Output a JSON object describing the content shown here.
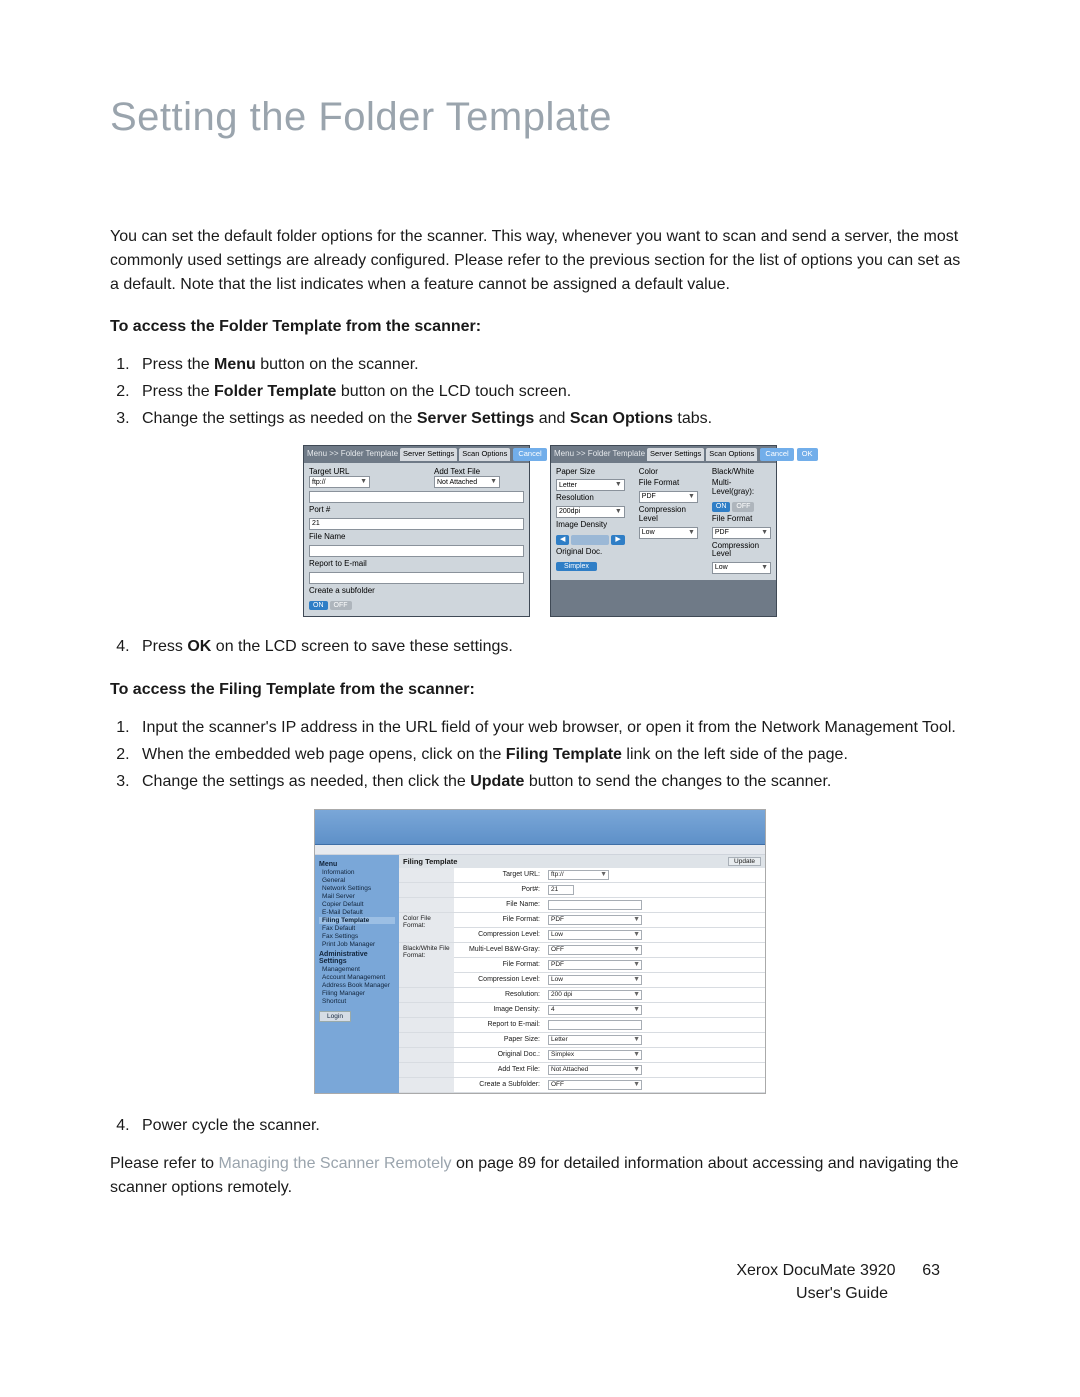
{
  "title": "Setting the Folder Template",
  "intro": "You can set the default folder options for the scanner. This way, whenever you want to scan and send a server, the most commonly used settings are already configured. Please refer to the previous section for the list of options you can set as a default. Note that the list indicates when a feature cannot be assigned a default value.",
  "section1_heading": "To access the Folder Template from the scanner:",
  "section1_steps": {
    "s1a": "Press the ",
    "s1b": "Menu",
    "s1c": " button on the scanner.",
    "s2a": "Press the ",
    "s2b": "Folder Template",
    "s2c": " button on the LCD touch screen.",
    "s3a": "Change the settings as needed on the ",
    "s3b": "Server Settings",
    "s3c": " and ",
    "s3d": "Scan Options",
    "s3e": " tabs.",
    "s4a": "Press ",
    "s4b": "OK",
    "s4c": " on the LCD screen to save these settings."
  },
  "section2_heading": "To access the Filing Template from the scanner:",
  "section2_steps": {
    "s1": "Input the scanner's IP address in the URL field of your web browser, or open it from the Network Management Tool.",
    "s2a": "When the embedded web page opens, click on the ",
    "s2b": "Filing Template",
    "s2c": " link on the left side of the page.",
    "s3a": "Change the settings as needed, then click the ",
    "s3b": "Update",
    "s3c": " button to send the changes to the scanner.",
    "s4": "Power cycle the scanner."
  },
  "closing_a": "Please refer to ",
  "closing_link": "Managing the Scanner Remotely",
  "closing_b": " on page 89 for detailed information about accessing and navigating the scanner options remotely.",
  "lcd": {
    "crumb": "Menu >> Folder Template",
    "tab_server": "Server Settings",
    "tab_scan": "Scan Options",
    "cancel": "Cancel",
    "ok": "OK",
    "panel1": {
      "target_url": "Target URL",
      "target_url_val": "ftp://",
      "add_text": "Add Text File",
      "add_text_val": "Not Attached",
      "port": "Port #",
      "port_val": "21",
      "file_name": "File Name",
      "report": "Report to E-mail",
      "subfolder": "Create a subfolder",
      "on": "ON",
      "off": "OFF"
    },
    "panel2": {
      "paper": "Paper Size",
      "paper_val": "Letter",
      "resolution": "Resolution",
      "resolution_val": "200dpi",
      "density": "Image Density",
      "original": "Original Doc.",
      "simplex": "Simplex",
      "color": "Color",
      "file_format": "File Format",
      "pdf": "PDF",
      "comp": "Compression Level",
      "low": "Low",
      "bw": "Black/White",
      "multi": "Multi-Level(gray):",
      "on": "ON",
      "off": "OFF"
    }
  },
  "web": {
    "side_menu": "Menu",
    "side": {
      "info": "Information",
      "general": "General",
      "netset": "Network Settings",
      "mail": "Mail Server",
      "copier": "Copier Default",
      "email": "E-Mail Default",
      "filing": "Filing Template",
      "faxd": "Fax Default",
      "faxs": "Fax Settings",
      "jobm": "Print Job Manager",
      "admin": "Administrative Settings",
      "mgmt": "Management",
      "acct": "Account Management",
      "abm": "Address Book Manager",
      "fm": "Filing Manager",
      "short": "Shortcut",
      "login": "Login"
    },
    "title": "Filing Template",
    "update": "Update",
    "group_color": "Color File Format:",
    "group_bw": "Black/White File Format:",
    "rows": {
      "target_url": "Target URL:",
      "target_url_val": "ftp://",
      "port": "Port#:",
      "port_val": "21",
      "file_name": "File Name:",
      "file_format": "File Format:",
      "pdf": "PDF",
      "comp": "Compression Level:",
      "low": "Low",
      "multi": "Multi-Level B&W-Gray:",
      "off": "OFF",
      "resolution": "Resolution:",
      "res_val": "200 dpi",
      "density": "Image Density:",
      "density_val": "4",
      "report": "Report to E-mail:",
      "paper": "Paper Size:",
      "paper_val": "Letter",
      "original": "Original Doc.:",
      "simplex": "Simplex",
      "addtext": "Add Text File:",
      "addtext_val": "Not Attached",
      "subfolder": "Create a Subfolder:"
    }
  },
  "footer": {
    "line1a": "Xerox DocuMate 3920",
    "line1_page": "63",
    "line2": "User's Guide"
  }
}
